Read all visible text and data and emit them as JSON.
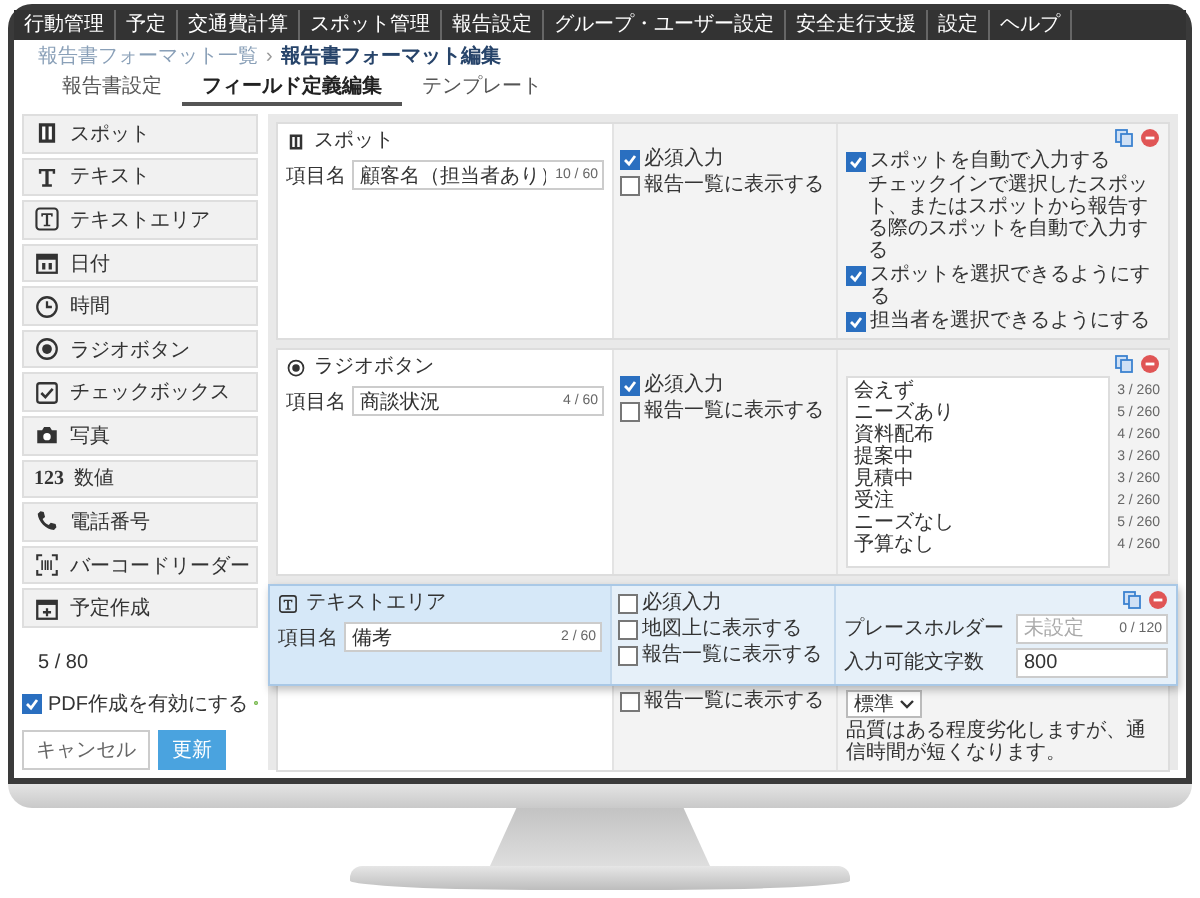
{
  "nav": [
    "行動管理",
    "予定",
    "交通費計算",
    "スポット管理",
    "報告設定",
    "グループ・ユーザー設定",
    "安全走行支援",
    "設定",
    "ヘルプ"
  ],
  "breadcrumb": {
    "link": "報告書フォーマット一覧",
    "separator": "›",
    "current": "報告書フォーマット編集"
  },
  "tabs": [
    {
      "label": "報告書設定",
      "selected": false
    },
    {
      "label": "フィールド定義編集",
      "selected": true
    },
    {
      "label": "テンプレート",
      "selected": false
    }
  ],
  "palette": [
    {
      "kind": "spot",
      "label": "スポット"
    },
    {
      "kind": "text",
      "label": "テキスト"
    },
    {
      "kind": "textarea",
      "label": "テキストエリア"
    },
    {
      "kind": "date",
      "label": "日付"
    },
    {
      "kind": "time",
      "label": "時間"
    },
    {
      "kind": "radio",
      "label": "ラジオボタン"
    },
    {
      "kind": "checkbox",
      "label": "チェックボックス"
    },
    {
      "kind": "photo",
      "label": "写真"
    },
    {
      "kind": "number",
      "label": "数値",
      "icon_text": "123"
    },
    {
      "kind": "phone",
      "label": "電話番号"
    },
    {
      "kind": "barcode",
      "label": "バーコードリーダー"
    },
    {
      "kind": "schedule",
      "label": "予定作成"
    }
  ],
  "field_count": "5 / 80",
  "pdf_option": {
    "label": "PDF作成を有効にする",
    "checked": true
  },
  "buttons": [
    {
      "label": "キャンセル",
      "kind": "secondary"
    },
    {
      "label": "更新",
      "kind": "primary"
    }
  ],
  "fields": [
    {
      "kind": "spot",
      "title": "スポット",
      "name_label": "項目名",
      "name": "顧客名（担当者あり）",
      "counter": "10 / 60",
      "options": [
        {
          "label": "必須入力",
          "checked": true
        },
        {
          "label": "報告一覧に表示する",
          "checked": false
        }
      ],
      "settings": [
        {
          "kind": "check",
          "label": "スポットを自動で入力する",
          "checked": true
        },
        {
          "kind": "note",
          "label": "チェックインで選択したスポット、またはスポットから報告する際のスポットを自動で入力する"
        },
        {
          "kind": "check",
          "label": "スポットを選択できるようにする",
          "checked": true
        },
        {
          "kind": "check",
          "label": "担当者を選択できるようにする",
          "checked": true
        }
      ]
    },
    {
      "kind": "radio",
      "title": "ラジオボタン",
      "name_label": "項目名",
      "name": "商談状況",
      "counter": "4 / 60",
      "options": [
        {
          "label": "必須入力",
          "checked": true
        },
        {
          "label": "報告一覧に表示する",
          "checked": false
        }
      ],
      "choices": [
        {
          "label": "会えず",
          "counter": "3 / 260"
        },
        {
          "label": "ニーズあり",
          "counter": "5 / 260"
        },
        {
          "label": "資料配布",
          "counter": "4 / 260"
        },
        {
          "label": "提案中",
          "counter": "3 / 260"
        },
        {
          "label": "見積中",
          "counter": "3 / 260"
        },
        {
          "label": "受注",
          "counter": "2 / 260"
        },
        {
          "label": "ニーズなし",
          "counter": "5 / 260"
        },
        {
          "label": "予算なし",
          "counter": "4 / 260"
        }
      ]
    },
    {
      "kind": "photo",
      "options": [
        {
          "label": "報告一覧に表示する",
          "checked": false
        }
      ],
      "quality": "標準",
      "note": "品質はある程度劣化しますが、通信時間が短くなります。"
    }
  ],
  "dragging": {
    "kind": "textarea",
    "title": "テキストエリア",
    "name_label": "項目名",
    "name": "備考",
    "counter": "2 / 60",
    "options": [
      {
        "label": "必須入力",
        "checked": false
      },
      {
        "label": "地図上に表示する",
        "checked": false
      },
      {
        "label": "報告一覧に表示する",
        "checked": false
      }
    ],
    "settings": [
      {
        "label": "プレースホルダー",
        "placeholder": "未設定",
        "counter": "0 / 120"
      },
      {
        "label": "入力可能文字数",
        "value": "800"
      }
    ]
  }
}
